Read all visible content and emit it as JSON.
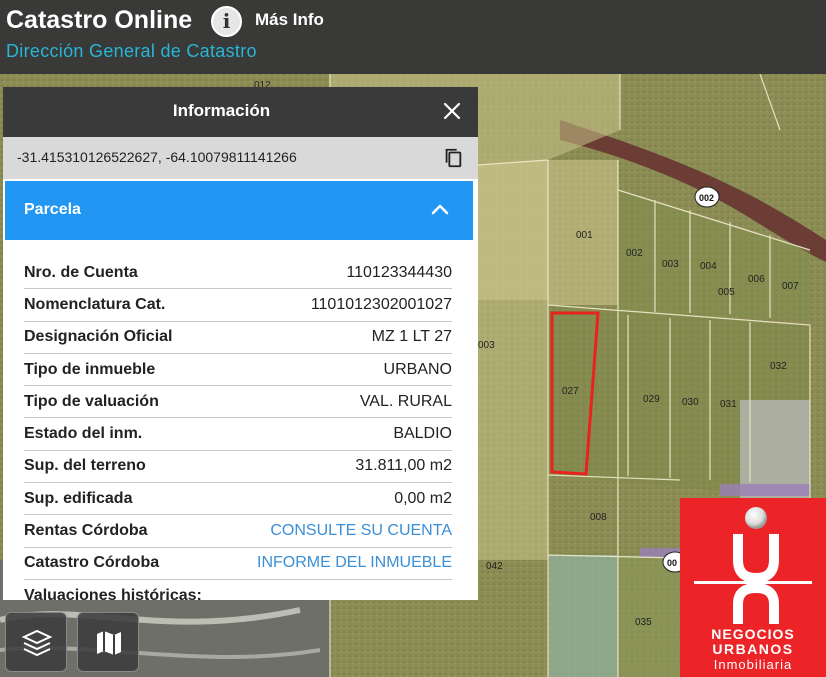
{
  "header": {
    "title": "Catastro Online",
    "subtitle": "Dirección General de Catastro",
    "info_icon_glyph": "i",
    "more_info_label": "Más Info"
  },
  "panel": {
    "title": "Información",
    "coordinates": "-31.415310126522627, -64.10079811141266",
    "section_title": "Parcela",
    "rows": [
      {
        "label": "Nro. de Cuenta",
        "value": "110123344430",
        "link": false
      },
      {
        "label": "Nomenclatura Cat.",
        "value": "1101012302001027",
        "link": false
      },
      {
        "label": "Designación Oficial",
        "value": "MZ 1 LT 27",
        "link": false
      },
      {
        "label": "Tipo de inmueble",
        "value": "URBANO",
        "link": false
      },
      {
        "label": "Tipo de valuación",
        "value": "VAL. RURAL",
        "link": false
      },
      {
        "label": "Estado del inm.",
        "value": "BALDIO",
        "link": false
      },
      {
        "label": "Sup. del terreno",
        "value": "31.811,00 m2",
        "link": false
      },
      {
        "label": "Sup. edificada",
        "value": "0,00 m2",
        "link": false
      },
      {
        "label": "Rentas Córdoba",
        "value": "CONSULTE SU CUENTA",
        "link": true
      },
      {
        "label": "Catastro Córdoba",
        "value": "INFORME DEL INMUEBLE",
        "link": true
      },
      {
        "label": "Valuaciones históricas:",
        "value": "",
        "link": false
      }
    ]
  },
  "map": {
    "parcel_labels": [
      "012",
      "001",
      "002",
      "003",
      "004",
      "006",
      "005",
      "007",
      "003",
      "027",
      "029",
      "030",
      "031",
      "032",
      "008",
      "042",
      "035"
    ],
    "road_badges": [
      "002",
      "00"
    ],
    "highlight_color": "#e8221c",
    "parcel_line_color": "#f5f0d0"
  },
  "controls": {
    "layers_icon": "layers-icon",
    "basemap_icon": "map-icon"
  },
  "logo": {
    "line1": "NEGOCIOS",
    "line2": "URBANOS",
    "line3": "Inmobiliaria",
    "color": "#ec2327"
  },
  "colors": {
    "header_bg": "#373737",
    "subtitle": "#27b6d6",
    "section_bg": "#2196f3",
    "link": "#3a8fd6"
  }
}
